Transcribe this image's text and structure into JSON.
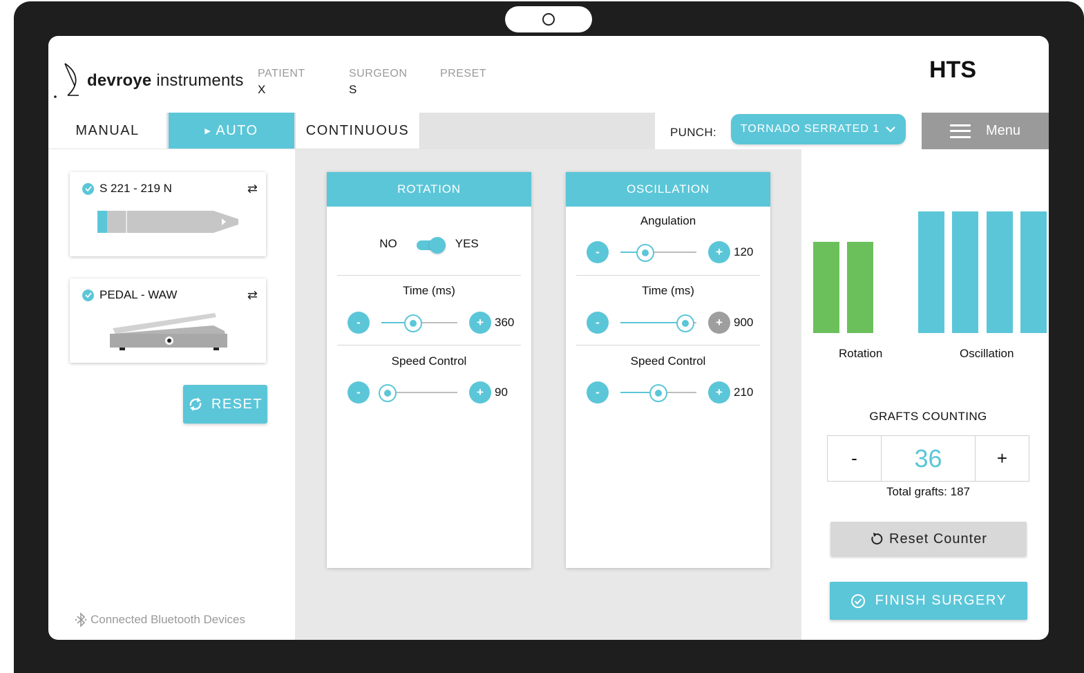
{
  "colors": {
    "accent": "#5bc6d8",
    "rotation_bar": "#6cc05c",
    "oscillation_bar": "#5bc6d8",
    "menu_bg": "#9a9a9a"
  },
  "header": {
    "brand_bold": "devroye",
    "brand_light": "instruments",
    "patient_label": "PATIENT",
    "patient_value": "X",
    "surgeon_label": "SURGEON",
    "surgeon_value": "S",
    "preset_label": "PRESET",
    "preset_value": "",
    "app_code": "HTS"
  },
  "tabs": {
    "manual": "MANUAL",
    "auto": "AUTO",
    "continuous": "CONTINUOUS",
    "active": "AUTO"
  },
  "punch": {
    "label": "PUNCH:",
    "selected": "TORNADO SERRATED 1"
  },
  "menu": {
    "label": "Menu"
  },
  "devices": [
    {
      "name": "S 221 - 219 N",
      "icon": "handpiece-icon",
      "connected": true
    },
    {
      "name": "PEDAL - WAW",
      "icon": "pedal-icon",
      "connected": true
    }
  ],
  "reset_label": "RESET",
  "bluetooth_label": "Connected Bluetooth Devices",
  "rotation": {
    "title": "ROTATION",
    "toggle_no": "NO",
    "toggle_yes": "YES",
    "enabled": true,
    "time_label": "Time (ms)",
    "time_value": "360",
    "time_level": 0.42,
    "speed_label": "Speed Control",
    "speed_value": "90",
    "speed_level": 0.08
  },
  "oscillation": {
    "title": "OSCILLATION",
    "angulation_label": "Angulation",
    "angulation_value": "120",
    "angulation_level": 0.33,
    "time_label": "Time (ms)",
    "time_value": "900",
    "time_level": 0.85,
    "speed_label": "Speed Control",
    "speed_value": "210",
    "speed_level": 0.5
  },
  "visual": {
    "rotation_label": "Rotation",
    "oscillation_label": "Oscillation",
    "rotation_bars": 2,
    "oscillation_bars": 4
  },
  "grafts": {
    "title": "GRAFTS COUNTING",
    "minus": "-",
    "plus": "+",
    "count": "36",
    "total": "Total grafts: 187",
    "reset_counter": "Reset Counter",
    "finish": "FINISH SURGERY"
  }
}
